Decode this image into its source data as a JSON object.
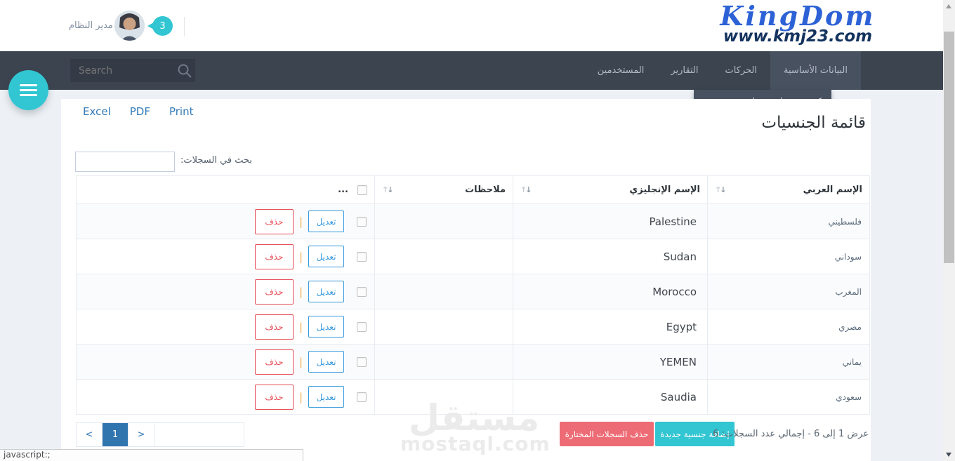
{
  "colors": {
    "teal": "#32c5d2",
    "red": "#ed6b75",
    "red_border": "#e7505a",
    "blue": "#3598dc",
    "link": "#337ab7",
    "navbar": "#3c4450",
    "logo_blue": "#2d62d6",
    "logo_navy": "#14335e"
  },
  "header": {
    "logo_title": "KingDom",
    "logo_subtitle": "www.kmj23.com",
    "user_name": "مدير النظام",
    "notification_count": "3"
  },
  "navbar": {
    "search_placeholder": "Search",
    "items": [
      {
        "label": "البيانات الأساسية",
        "active": true
      },
      {
        "label": "الحركات",
        "active": false
      },
      {
        "label": "التقارير",
        "active": false
      },
      {
        "label": "المستخدمين",
        "active": false
      }
    ],
    "dropdown": {
      "items": [
        {
          "label": "كشف حساب عميل"
        }
      ]
    }
  },
  "toolbar": {
    "export_buttons": [
      "Excel",
      "PDF",
      "Print"
    ]
  },
  "page": {
    "title": "قائمة الجنسيات"
  },
  "search": {
    "label": "بحث في السجلات:",
    "value": ""
  },
  "table": {
    "columns": [
      {
        "label": "الإسم العربي",
        "sortable": true
      },
      {
        "label": "الإسم الإنجليزي",
        "sortable": true
      },
      {
        "label": "ملاحظات",
        "sortable": true
      },
      {
        "label": "...",
        "sortable": false
      }
    ],
    "rows": [
      {
        "arabic": "فلسطيني",
        "english": "Palestine",
        "notes": ""
      },
      {
        "arabic": "سوداني",
        "english": "Sudan",
        "notes": ""
      },
      {
        "arabic": "المغرب",
        "english": "Morocco",
        "notes": ""
      },
      {
        "arabic": "مصري",
        "english": "Egypt",
        "notes": ""
      },
      {
        "arabic": "يماني",
        "english": "YEMEN",
        "notes": ""
      },
      {
        "arabic": "سعودي",
        "english": "Saudia",
        "notes": ""
      }
    ],
    "row_actions": {
      "edit": "تعديل",
      "separator": "|",
      "delete": "حذف"
    }
  },
  "footer": {
    "pagination": {
      "prev": "<",
      "current": "1",
      "next": ">"
    },
    "info": "عرض 1 إلى 6 - إجمالي عدد السجلات: 6",
    "add_button": "إضافة جنسية جديدة",
    "delete_selected_button": "حذف السجلات المختارة"
  },
  "watermark": {
    "arabic": "مستقل",
    "domain": "mostaql.com"
  },
  "statusbar": {
    "text": "javascript:;"
  }
}
